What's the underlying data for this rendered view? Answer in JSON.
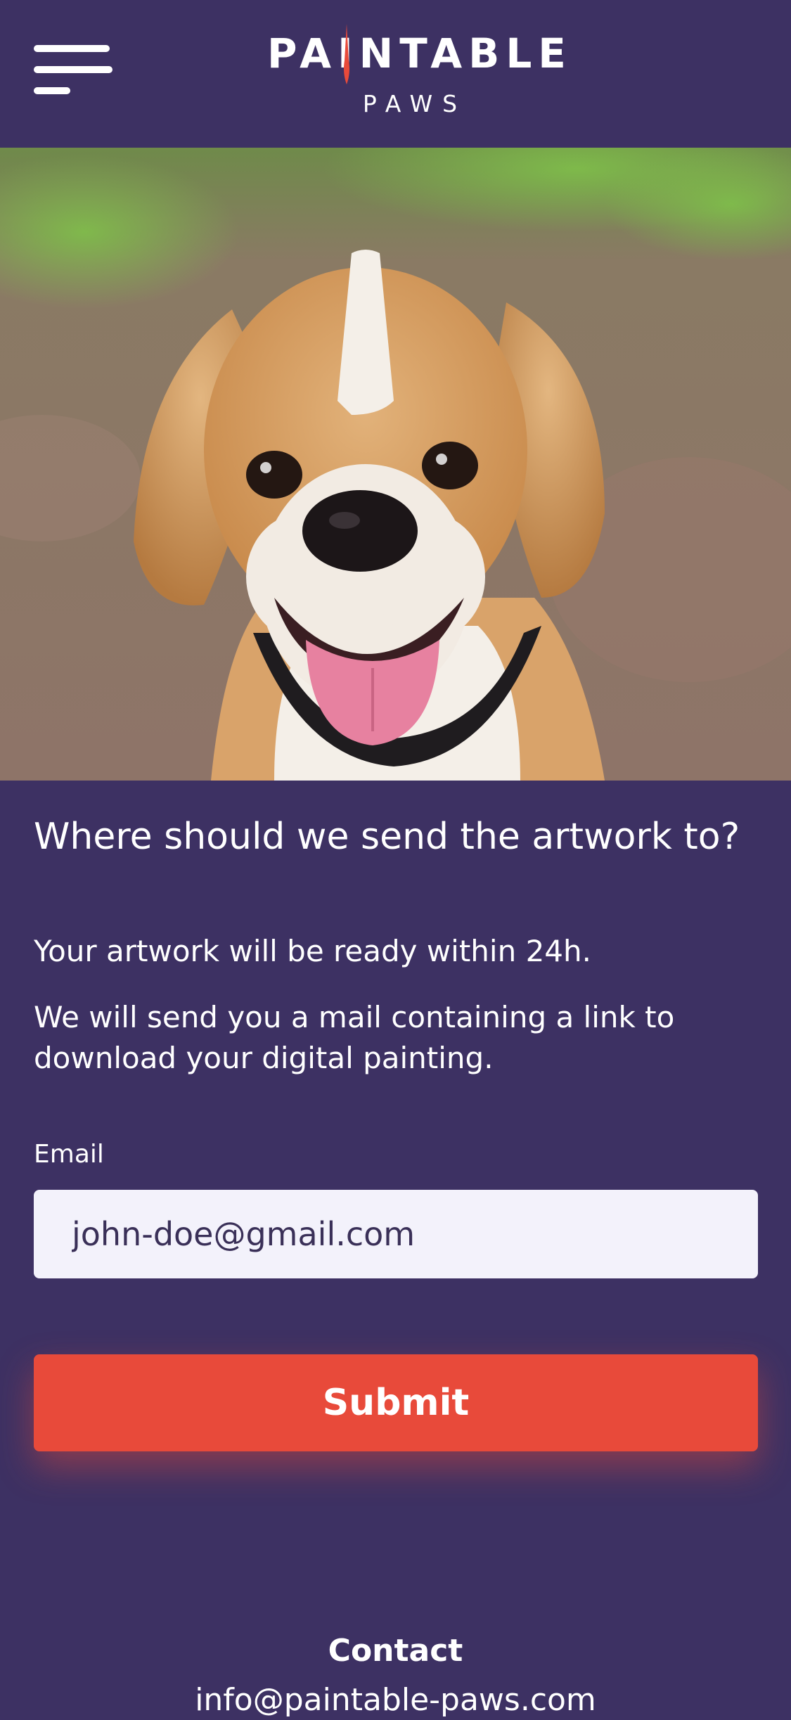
{
  "header": {
    "logo_title": "PAINTABLE",
    "logo_subtitle": "PAWS",
    "menu_icon": "hamburger-menu-icon"
  },
  "hero": {
    "image_subject": "beagle dog photo"
  },
  "form": {
    "heading": "Where should we send the artwork to?",
    "ready_text": "Your artwork will be ready within 24h.",
    "mail_text": "We will send you a mail containing a link to download your digital painting.",
    "email_label": "Email",
    "email_placeholder": "john-doe@gmail.com",
    "submit_label": "Submit"
  },
  "footer": {
    "contact_title": "Contact",
    "contact_email": "info@paintable-paws.com"
  },
  "colors": {
    "background": "#3d3163",
    "accent": "#e84a3a",
    "input_background": "#f3f2fb"
  }
}
